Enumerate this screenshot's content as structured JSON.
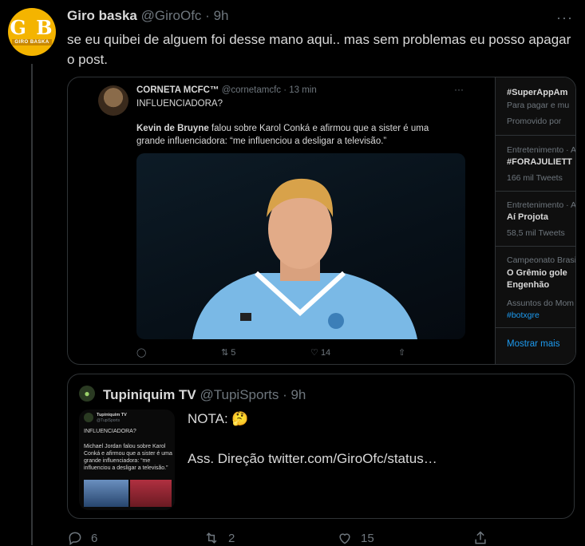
{
  "tweet": {
    "avatar_text": "G B",
    "avatar_subtext": "GIRO BASKA",
    "name": "Giro baska",
    "handle": "@GiroOfc",
    "separator": "·",
    "time": "9h",
    "more": "···",
    "text": "se eu quibei de alguem foi desse mano aqui.. mas sem problemas eu posso apagar o post.",
    "replies": "6",
    "retweets": "2",
    "likes": "15"
  },
  "screenshot": {
    "name": "CORNETA MCFC™",
    "handle": "@cornetamcfc",
    "time": "· 13 min",
    "more": "···",
    "line1": "INFLUENCIADORA?",
    "bold": "Kevin de Bruyne",
    "text": " falou sobre Karol Conká e afirmou que a sister é uma grande influenciadora: “me influenciou a desligar a televisão.”",
    "replies": "",
    "retweets": "5",
    "likes": "14",
    "sidebar": {
      "s1_title": "#SuperAppAm",
      "s1_meta": "Para pagar e mu",
      "s1_promo": "Promovido por",
      "s2_cat": "Entretenimento · A",
      "s2_title": "#FORAJULIETT",
      "s2_meta": "166 mil Tweets",
      "s3_cat": "Entretenimento · A",
      "s3_title": "Aí Projota",
      "s3_meta": "58,5 mil Tweets",
      "s4_cat": "Campeonato Brasi",
      "s4_title1": "O Grêmio gole",
      "s4_title2": "Engenhão",
      "s4_meta": "Assuntos do Mom",
      "s4_tag": "#botxgre",
      "show_more": "Mostrar mais"
    }
  },
  "quote": {
    "name": "Tupiniquim TV",
    "handle": "@TupiSports",
    "time": "· 9h",
    "thumb_name": "Tupiniquim TV",
    "thumb_handle": "@TupiSports",
    "thumb_line1": "INFLUENCIADORA?",
    "thumb_text": "Michael Jordan falou sobre Karol Conká e afirmou que a sister é uma grande influenciadora: “me influenciou a desligar a televisão.”",
    "line1": "NOTA: 🤔",
    "line2": "Ass. Direção  twitter.com/GiroOfc/status…"
  },
  "colors": {
    "background": "#000000",
    "accent": "#1d9bf0",
    "muted": "#6e767d",
    "avatar": "#f4b400"
  }
}
